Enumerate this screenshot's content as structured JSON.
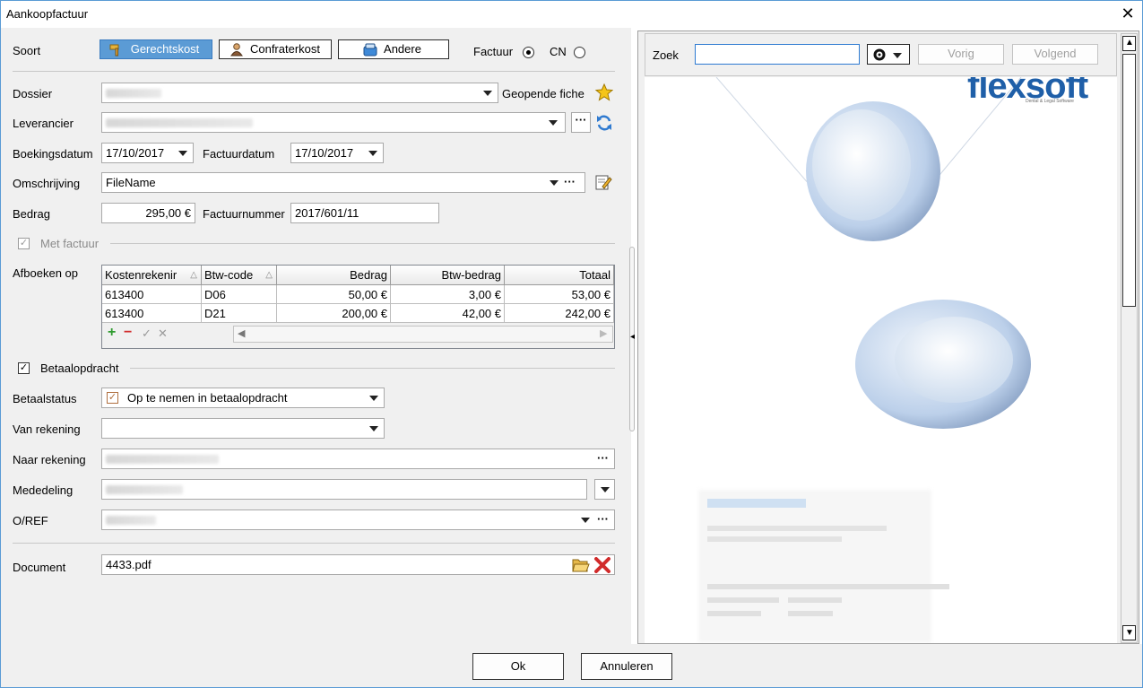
{
  "window": {
    "title": "Aankoopfactuur",
    "close_glyph": "✕"
  },
  "soort": {
    "label": "Soort",
    "buttons": [
      {
        "label": "Gerechtskost",
        "icon": "hammer-icon",
        "active": true
      },
      {
        "label": "Confraterkost",
        "icon": "person-icon",
        "active": false
      },
      {
        "label": "Andere",
        "icon": "box-icon",
        "active": false
      }
    ],
    "factuur_label": "Factuur",
    "cn_label": "CN",
    "selected": "Factuur"
  },
  "dossier": {
    "label": "Dossier",
    "geopende_fiche": "Geopende fiche"
  },
  "leverancier": {
    "label": "Leverancier"
  },
  "boekingsdatum": {
    "label": "Boekingsdatum",
    "value": "17/10/2017"
  },
  "factuurdatum": {
    "label": "Factuurdatum",
    "value": "17/10/2017"
  },
  "omschrijving": {
    "label": "Omschrijving",
    "value": "FileName"
  },
  "bedrag": {
    "label": "Bedrag",
    "value": "295,00 €"
  },
  "factuurnummer": {
    "label": "Factuurnummer",
    "value": "2017/601/11"
  },
  "met_factuur": {
    "label": "Met factuur",
    "checked": true
  },
  "afboeken": {
    "label": "Afboeken op",
    "columns": [
      "Kostenrekenir",
      "Btw-code",
      "Bedrag",
      "Btw-bedrag",
      "Totaal"
    ],
    "rows": [
      [
        "613400",
        "D06",
        "50,00 €",
        "3,00 €",
        "53,00 €"
      ],
      [
        "613400",
        "D21",
        "200,00 €",
        "42,00 €",
        "242,00 €"
      ]
    ],
    "tools": [
      "+",
      "−",
      "✓",
      "✕"
    ]
  },
  "betaalopdracht": {
    "label": "Betaalopdracht",
    "checked": true
  },
  "betaalstatus": {
    "label": "Betaalstatus",
    "value": "Op te nemen in betaalopdracht"
  },
  "van_rekening": {
    "label": "Van rekening"
  },
  "naar_rekening": {
    "label": "Naar rekening"
  },
  "mededeling": {
    "label": "Mededeling"
  },
  "oref": {
    "label": "O/REF"
  },
  "document": {
    "label": "Document",
    "value": "4433.pdf"
  },
  "search": {
    "label": "Zoek",
    "value": "",
    "prev": "Vorig",
    "next": "Volgend"
  },
  "preview": {
    "brand": "flexsoft",
    "tagline": "Dental & Legal Software"
  },
  "footer": {
    "ok": "Ok",
    "cancel": "Annuleren"
  },
  "colors": {
    "accent": "#5b9bd5",
    "panel": "#f0f0f0",
    "border": "#a9a9a9"
  }
}
